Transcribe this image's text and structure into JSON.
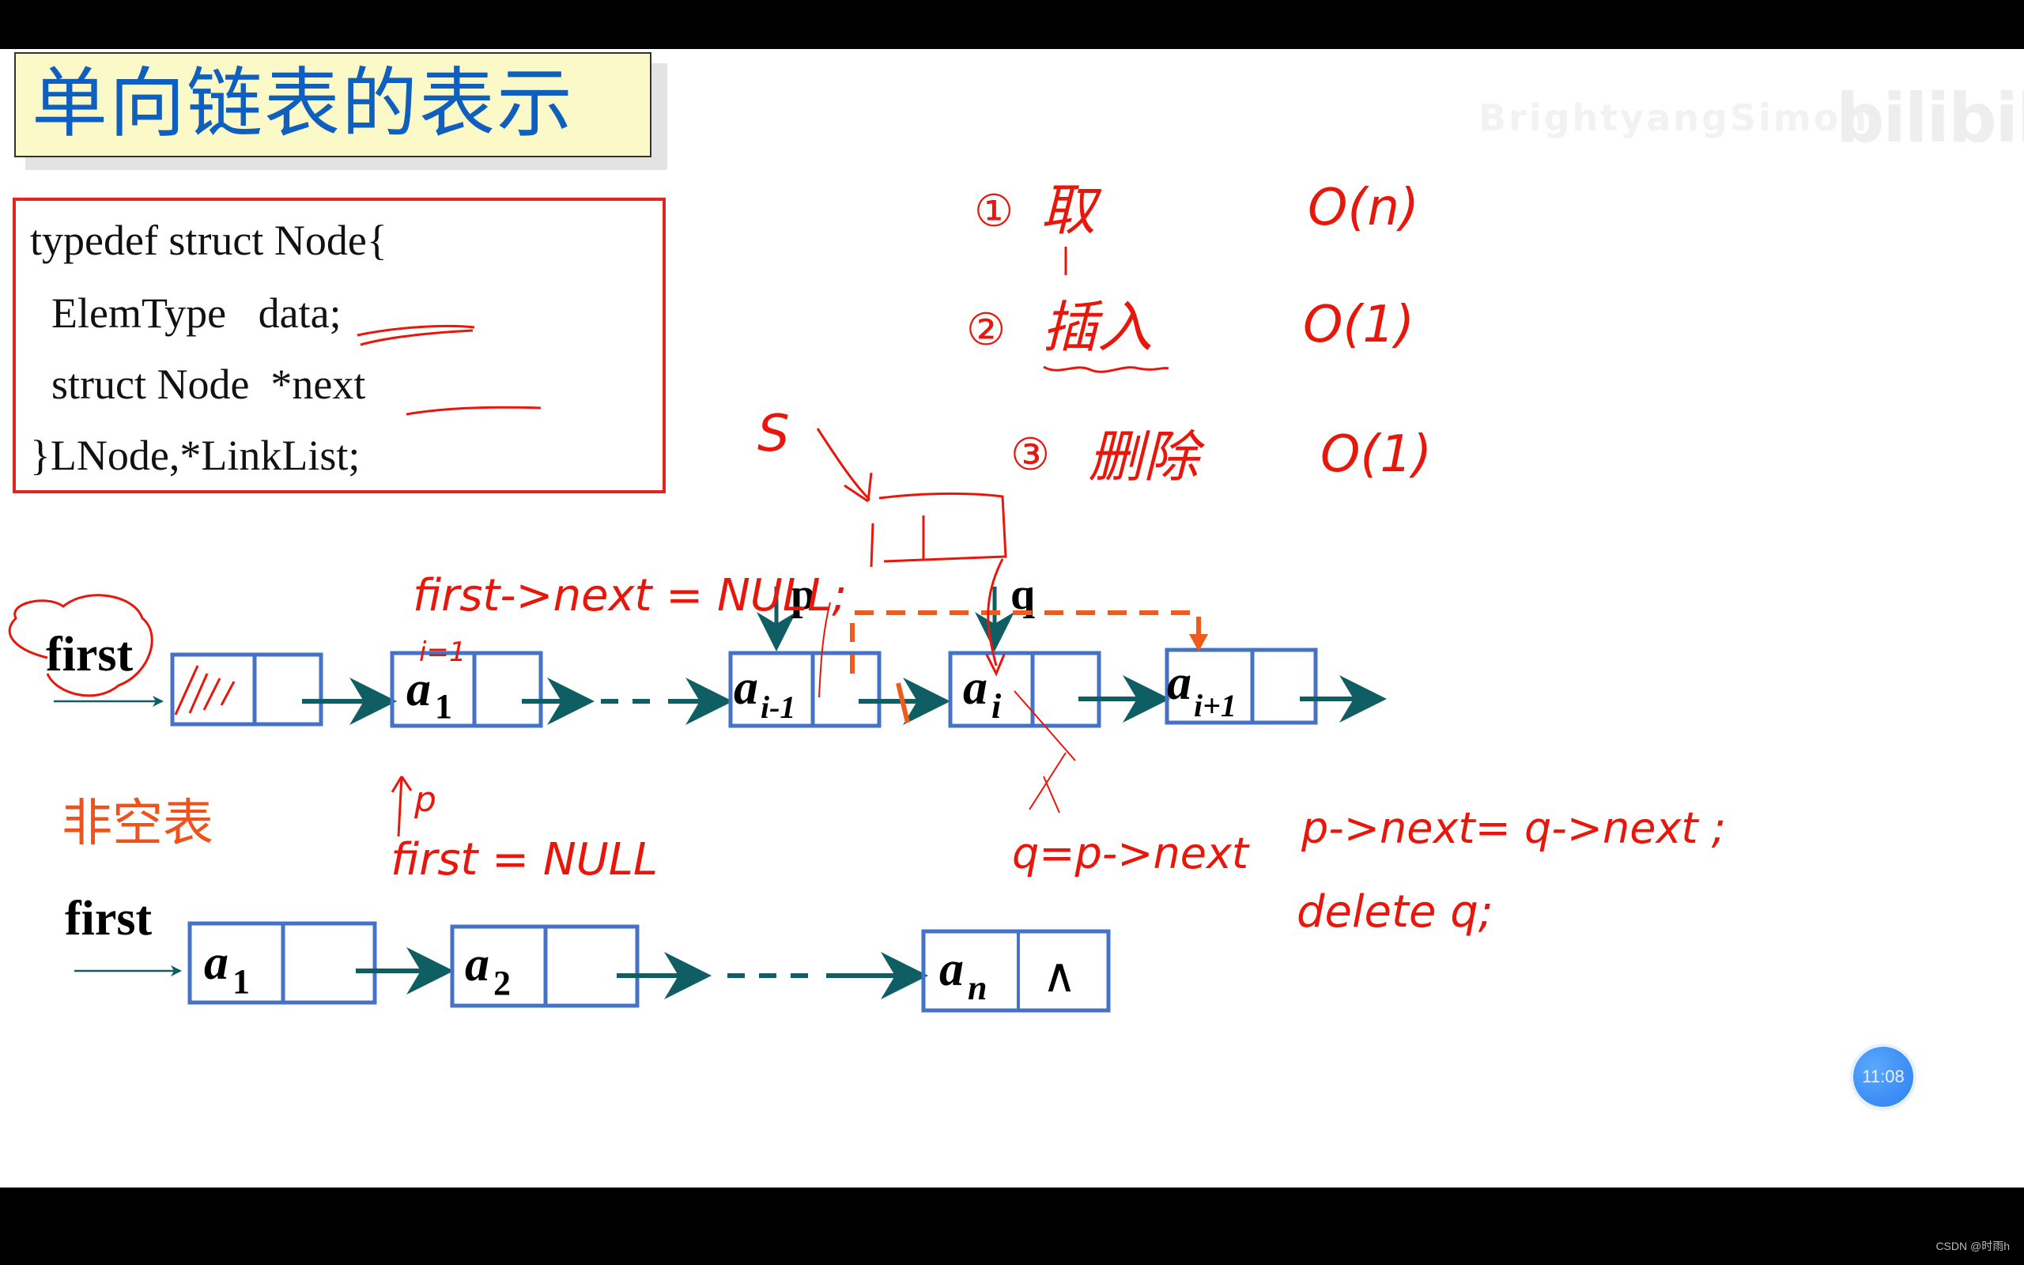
{
  "slide": {
    "title": "单向链表的表示",
    "code_lines": [
      "typedef struct Node{",
      "  ElemType   data;",
      "  struct Node  *next",
      "}LNode,*LinkList;"
    ],
    "nonempty_label": "非空表",
    "watermark_text": "BrightyangSimon",
    "watermark_logo": "bilibili"
  },
  "diagram_top": {
    "head_label": "first",
    "nodes": [
      {
        "name": "head",
        "letter": "",
        "sub": ""
      },
      {
        "name": "a1",
        "letter": "a",
        "sub": "1"
      },
      {
        "name": "ai-1",
        "letter": "a",
        "sub": "i-1"
      },
      {
        "name": "ai",
        "letter": "a",
        "sub": "i"
      },
      {
        "name": "ai+1",
        "letter": "a",
        "sub": "i+1"
      }
    ],
    "pointer_p": "p",
    "pointer_q": "q"
  },
  "diagram_bottom": {
    "head_label": "first",
    "nodes": [
      {
        "name": "a1",
        "letter": "a",
        "sub": "1"
      },
      {
        "name": "a2",
        "letter": "a",
        "sub": "2"
      },
      {
        "name": "an",
        "letter": "a",
        "sub": "n",
        "null_symbol": "∧"
      }
    ]
  },
  "annotations": {
    "ops": [
      {
        "num": "①",
        "op": "取",
        "complexity": "O(n)"
      },
      {
        "num": "②",
        "op": "插入",
        "complexity": "O(1)"
      },
      {
        "num": "③",
        "op": "删除",
        "complexity": "O(1)"
      }
    ],
    "s_label": "S",
    "first_next_null": "first->next = NULL;",
    "i_eq_1": "i=1",
    "p_mark": "p",
    "first_null": "first = NULL",
    "q_assign": "q=p->next",
    "p_next_assign": "p->next= q->next ;",
    "delete_q": "delete q;"
  },
  "overlay": {
    "timer": "11:08",
    "credit": "CSDN @时雨h"
  },
  "colors": {
    "title_blue": "#0f5fbf",
    "title_bg": "#fcf9c8",
    "code_border": "#e0261e",
    "node_border": "#4472c4",
    "arrow_teal": "#0e5e63",
    "dash_orange": "#f05a1a",
    "ink_red": "#e8170c",
    "timer_blue": "#2c7ff0"
  }
}
